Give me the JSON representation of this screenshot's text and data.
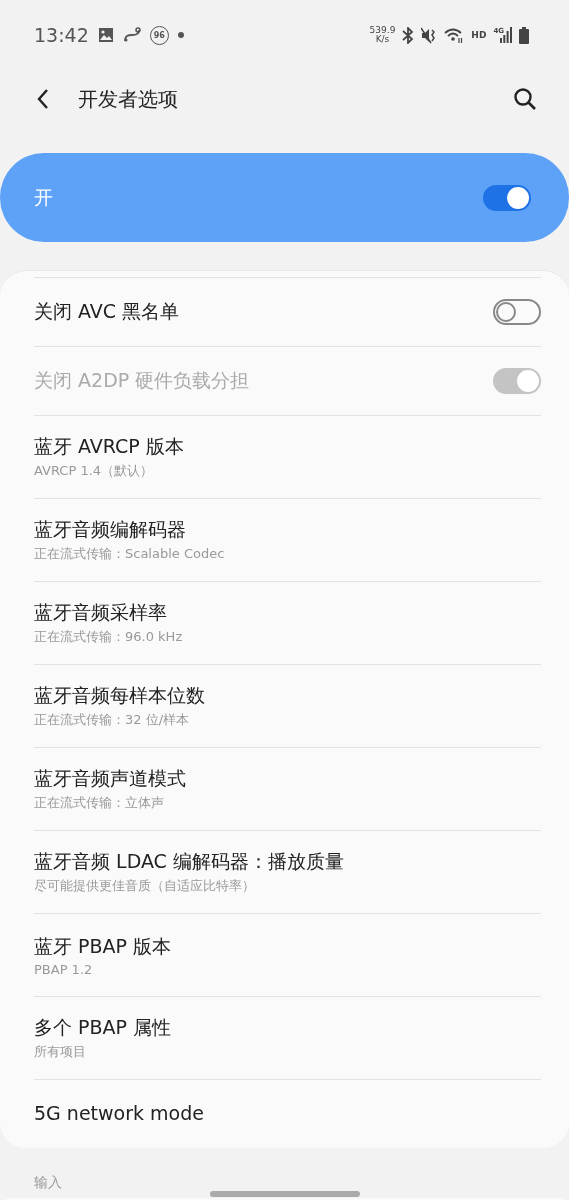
{
  "status_bar": {
    "time": "13:42",
    "notification_badge": "96",
    "net_speed": "539.9",
    "net_speed_unit": "K/s",
    "hd": "HD",
    "network": "4G"
  },
  "header": {
    "title": "开发者选项"
  },
  "master_switch": {
    "label": "开",
    "on": true
  },
  "settings": [
    {
      "kind": "switch",
      "title": "关闭 AVC 黑名单",
      "on": false,
      "disabled": false
    },
    {
      "kind": "switch",
      "title": "关闭 A2DP 硬件负载分担",
      "on": true,
      "disabled": true
    },
    {
      "kind": "info",
      "title": "蓝牙 AVRCP 版本",
      "summary": "AVRCP 1.4（默认）"
    },
    {
      "kind": "info",
      "title": "蓝牙音频编解码器",
      "summary": "正在流式传输：Scalable Codec"
    },
    {
      "kind": "info",
      "title": "蓝牙音频采样率",
      "summary": "正在流式传输：96.0 kHz"
    },
    {
      "kind": "info",
      "title": "蓝牙音频每样本位数",
      "summary": "正在流式传输：32 位/样本"
    },
    {
      "kind": "info",
      "title": "蓝牙音频声道模式",
      "summary": "正在流式传输：立体声"
    },
    {
      "kind": "info",
      "title": "蓝牙音频 LDAC 编解码器：播放质量",
      "summary": "尽可能提供更佳音质（自适应比特率）"
    },
    {
      "kind": "info",
      "title": "蓝牙 PBAP 版本",
      "summary": "PBAP 1.2"
    },
    {
      "kind": "info",
      "title": "多个 PBAP 属性",
      "summary": "所有项目"
    },
    {
      "kind": "info",
      "title": "5G network mode"
    }
  ],
  "next_section": {
    "title": "输入"
  }
}
